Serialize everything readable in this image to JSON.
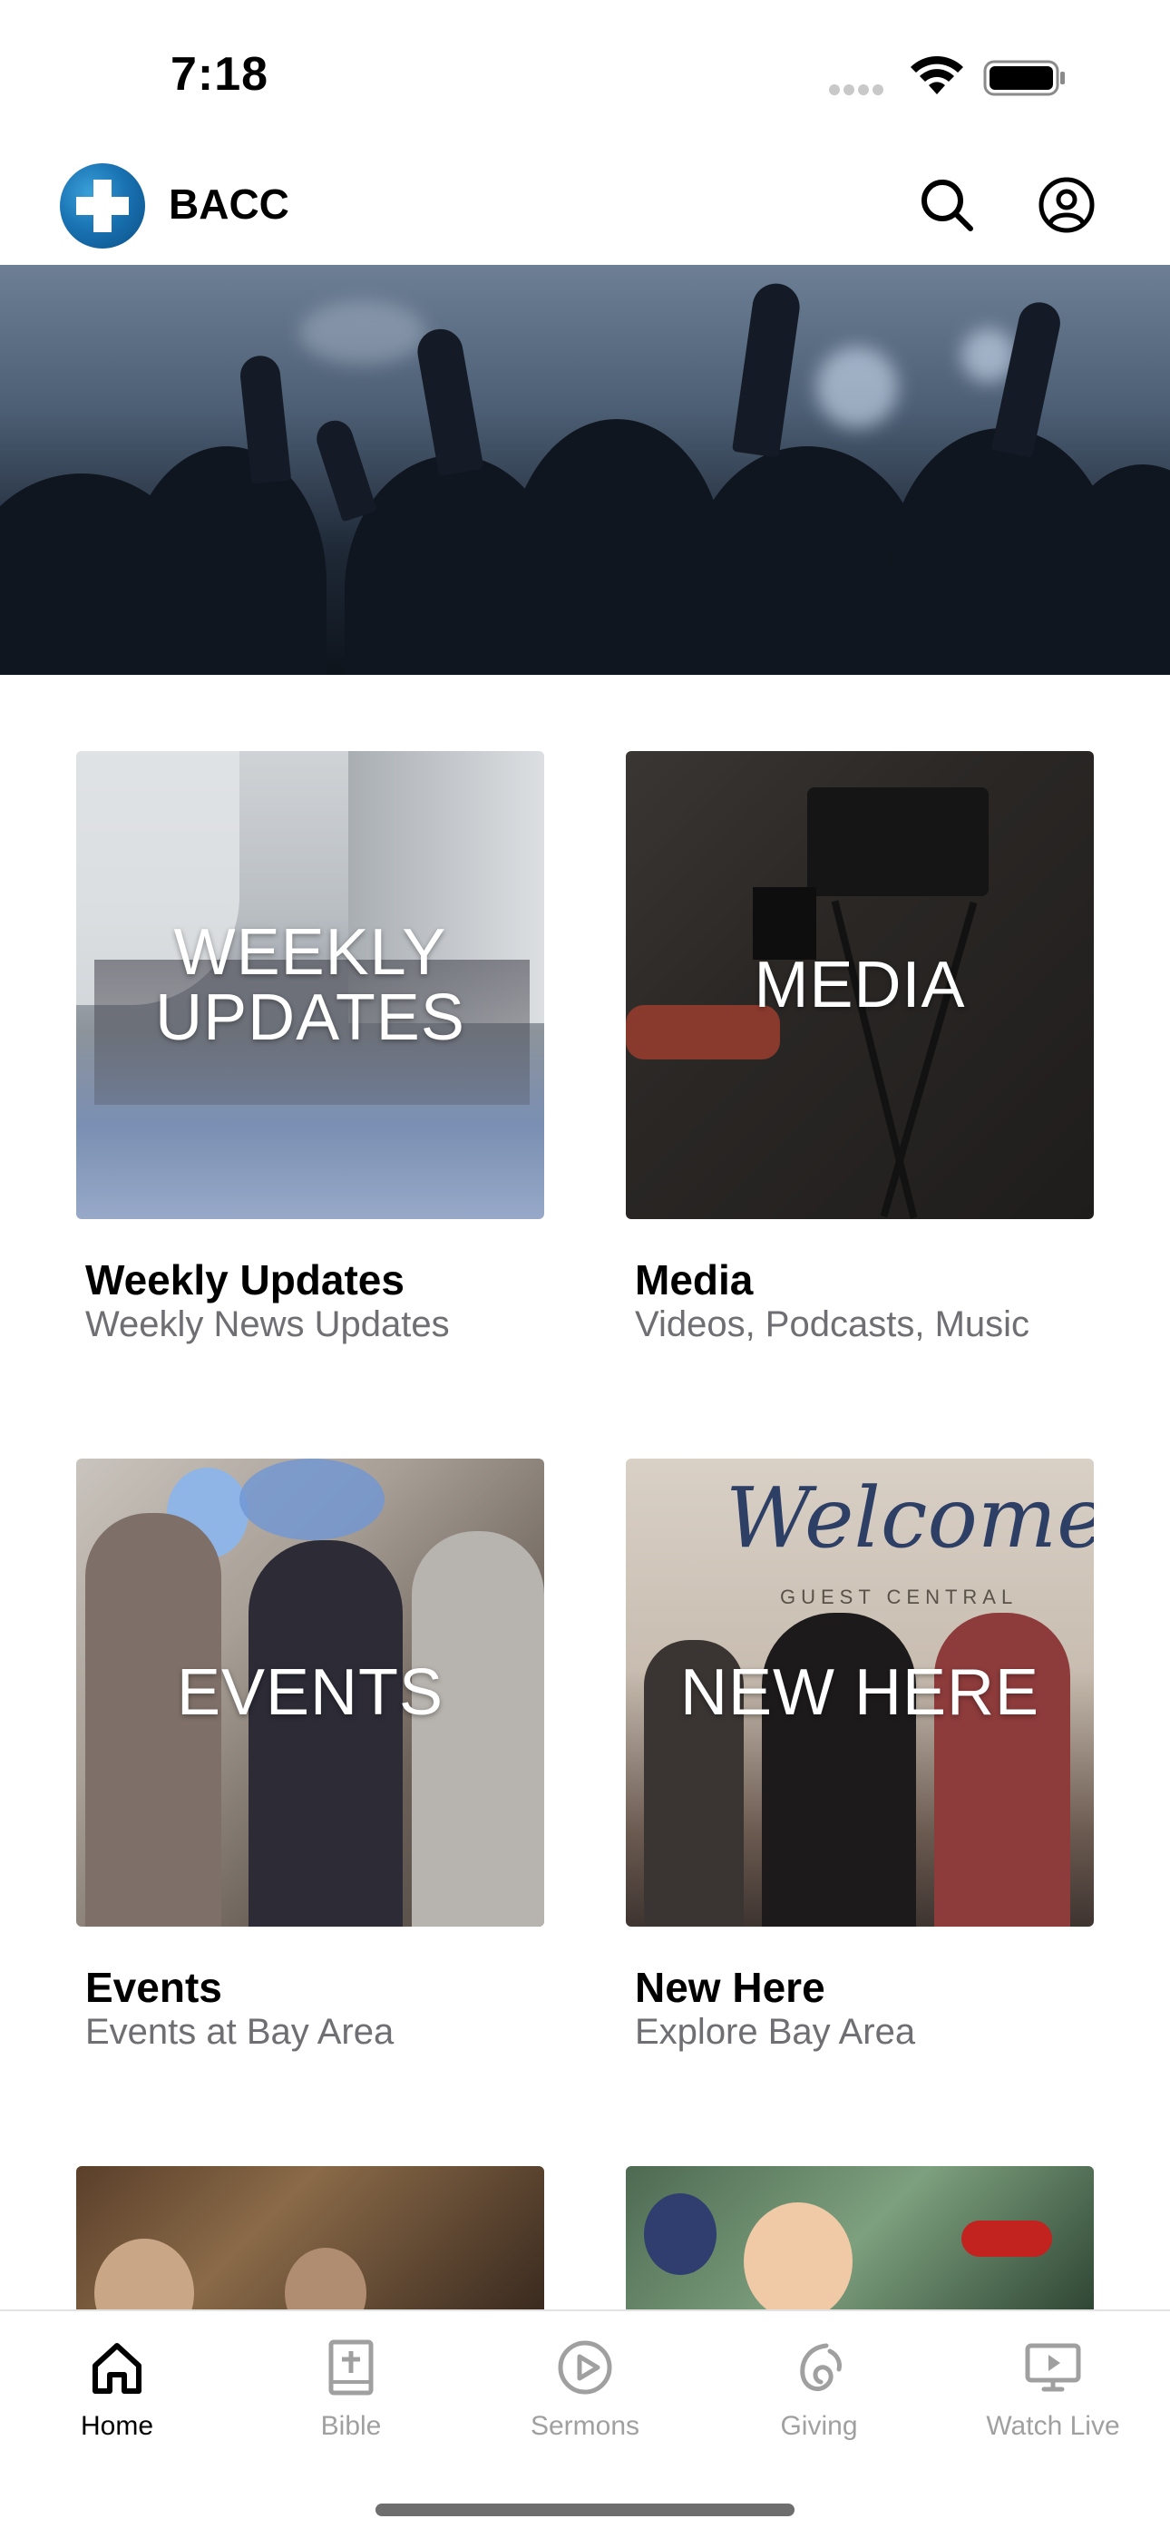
{
  "status_bar": {
    "time": "7:18"
  },
  "header": {
    "app_name": "BACC"
  },
  "tiles": [
    {
      "overlay": "WEEKLY\nUPDATES",
      "title": "Weekly Updates",
      "subtitle": "Weekly News Updates"
    },
    {
      "overlay": "MEDIA",
      "title": "Media",
      "subtitle": "Videos, Podcasts, Music"
    },
    {
      "overlay": "EVENTS",
      "title": "Events",
      "subtitle": "Events at Bay Area"
    },
    {
      "overlay": "NEW HERE",
      "title": "New Here",
      "subtitle": "Explore Bay Area"
    }
  ],
  "new_here_sign": {
    "script": "Welcome",
    "caption": "GUEST CENTRAL"
  },
  "tab_bar": {
    "tabs": [
      {
        "label": "Home",
        "icon": "home-icon",
        "active": true
      },
      {
        "label": "Bible",
        "icon": "bible-icon",
        "active": false
      },
      {
        "label": "Sermons",
        "icon": "play-circle-icon",
        "active": false
      },
      {
        "label": "Giving",
        "icon": "giving-icon",
        "active": false
      },
      {
        "label": "Watch Live",
        "icon": "tv-play-icon",
        "active": false
      }
    ]
  },
  "colors": {
    "active_tab": "#000000",
    "inactive_tab": "#a0a0a0",
    "subtitle": "#6e6e73",
    "brand_blue": "#1a73b3"
  }
}
